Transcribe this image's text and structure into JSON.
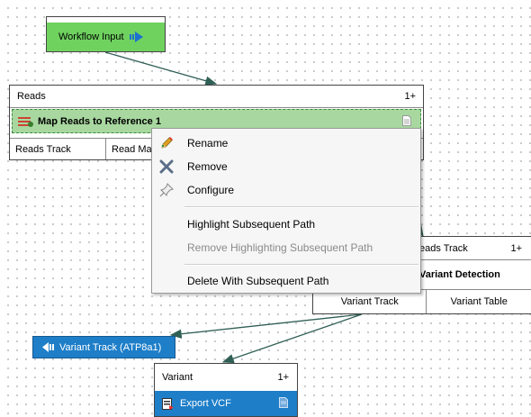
{
  "workflow_input": {
    "label": "Workflow Input"
  },
  "map_reads": {
    "input_label": "Reads",
    "input_count": "1+",
    "title": "Map Reads to Reference 1",
    "outputs": [
      "Reads Track",
      "Read Ma"
    ]
  },
  "context_menu": {
    "items": [
      {
        "label": "Rename",
        "icon": "pencil-icon",
        "enabled": true
      },
      {
        "label": "Remove",
        "icon": "x-icon",
        "enabled": true
      },
      {
        "label": "Configure",
        "icon": "pin-icon",
        "enabled": true
      },
      {
        "label": "Highlight Subsequent Path",
        "enabled": true
      },
      {
        "label": "Remove Highlighting Subsequent Path",
        "enabled": false
      },
      {
        "label": "Delete With Subsequent Path",
        "enabled": true
      }
    ]
  },
  "variant_detection": {
    "input_label": "eads Track",
    "input_count": "1+",
    "title": "Variant Detection",
    "outputs": [
      "Variant Track",
      "Variant Table"
    ]
  },
  "variant_track_output": {
    "label": "Variant Track (ATP8a1)"
  },
  "export_vcf": {
    "input_label": "Variant",
    "input_count": "1+",
    "title": "Export VCF"
  },
  "colors": {
    "input_green": "#6fd25f",
    "selected_green": "#a8d8a0",
    "output_blue": "#1e7ec8",
    "connector": "#2f5f55"
  }
}
